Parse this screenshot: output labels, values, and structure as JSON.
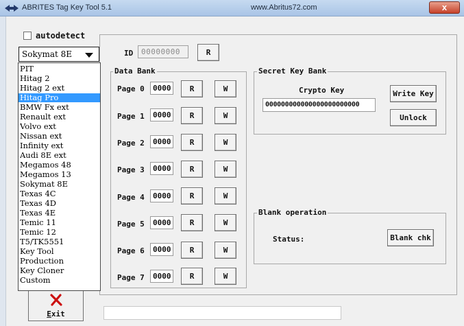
{
  "window": {
    "title": "ABRITES Tag Key Tool 5.1",
    "url": "www.Abritus72.com",
    "close_label": "x"
  },
  "autodetect": {
    "label": "autodetect",
    "checked": false
  },
  "tag_type": {
    "selected": "Sokymat 8E",
    "options": [
      "PIT",
      "Hitag 2",
      "Hitag 2 ext",
      "Hitag Pro",
      "BMW Fx  ext",
      "Renault ext",
      "Volvo   ext",
      "Nissan  ext",
      "Infinity ext",
      "Audi 8E ext",
      "Megamos 48",
      "Megamos 13",
      "Sokymat 8E",
      "Texas 4C",
      "Texas 4D",
      "Texas 4E",
      "Temic 11",
      "Temic 12",
      "T5/TK5551",
      "Key Tool",
      "Production",
      "Key Cloner",
      "Custom"
    ],
    "highlighted": "Hitag Pro"
  },
  "id_section": {
    "label": "ID",
    "value": "00000000",
    "read_label": "R"
  },
  "data_bank": {
    "title": "Data Bank",
    "pages": [
      {
        "label": "Page 0",
        "value": "0000",
        "read": "R",
        "write": "W"
      },
      {
        "label": "Page 1",
        "value": "0000",
        "read": "R",
        "write": "W"
      },
      {
        "label": "Page 2",
        "value": "0000",
        "read": "R",
        "write": "W"
      },
      {
        "label": "Page 3",
        "value": "0000",
        "read": "R",
        "write": "W"
      },
      {
        "label": "Page 4",
        "value": "0000",
        "read": "R",
        "write": "W"
      },
      {
        "label": "Page 5",
        "value": "0000",
        "read": "R",
        "write": "W"
      },
      {
        "label": "Page 6",
        "value": "0000",
        "read": "R",
        "write": "W"
      },
      {
        "label": "Page 7",
        "value": "0000",
        "read": "R",
        "write": "W"
      }
    ]
  },
  "secret_key_bank": {
    "title": "Secret Key Bank",
    "crypto_label": "Crypto Key",
    "crypto_value": "000000000000000000000000",
    "write_key_label": "Write Key",
    "unlock_label": "Unlock"
  },
  "blank_operation": {
    "title": "Blank operation",
    "status_label": "Status:",
    "blank_check_label": "Blank chk"
  },
  "exit_button": {
    "label": "Exit"
  },
  "status_bar": {
    "text": ""
  },
  "colors": {
    "selection": "#3399ff",
    "exit_icon": "#cc1111",
    "titlebar": "#b8cfe9",
    "close_button": "#c7412a"
  }
}
